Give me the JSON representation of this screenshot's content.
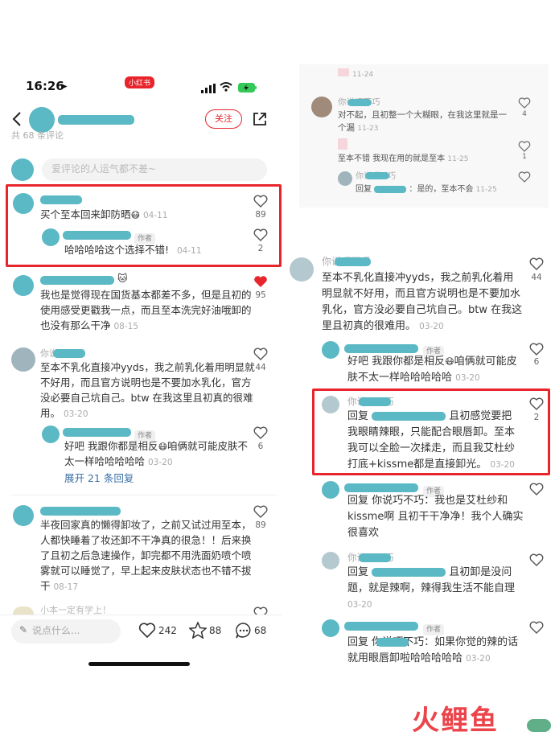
{
  "status_bar": {
    "time": "16:26",
    "app_badge": "小红书"
  },
  "header": {
    "follow_label": "关注",
    "count_label": "共 68 条评论"
  },
  "comment_input": {
    "placeholder": "爱评论的人运气都不差~"
  },
  "left_comments": [
    {
      "text": "买个至本回来卸防晒",
      "date": "04-11",
      "likes": "89"
    },
    {
      "author_tag": "作者",
      "text": "哈哈哈哈这个选择不错!",
      "date": "04-11",
      "likes": "2"
    },
    {
      "lines": [
        "我也是觉得现在国货基本都差不多，但是且初的",
        "使用感受更戳我一点，而且至本洗完好油哦卸的",
        "也没有那么干净"
      ],
      "date": "08-15",
      "likes": "95"
    },
    {
      "name": "你说巧不巧",
      "lines": [
        "至本不乳化直接冲yyds，我之前乳化着用明显就",
        "不好用，而且官方说明也是不要加水乳化，官方",
        "没必要自己坑自己。btw 在我这里且初真的很难",
        "用。"
      ],
      "date": "03-20",
      "likes": "44"
    },
    {
      "author_tag": "作者",
      "lines": [
        "好吧 我跟你都是相反",
        "咱俩就可能皮肤不",
        "太一样哈哈哈哈哈"
      ],
      "date": "03-20",
      "likes": "6"
    },
    {
      "expand": "展开 21 条回复"
    },
    {
      "lines": [
        "半夜回家真的懒得卸妆了，之前又试过用至本，",
        "人都快睡着了妆还卸不干净真的很急！！后来换",
        "了且初之后急速操作，卸完都不用洗面奶喷个喷",
        "雾就可以睡觉了，早上起来皮肤状态也不错不拔",
        "干"
      ],
      "date": "08-17",
      "likes": "89"
    },
    {
      "partial": "小本一定有学上！"
    }
  ],
  "bottom_bar": {
    "input_placeholder": "说点什么...",
    "likes": "242",
    "stars": "88",
    "comments": "68"
  },
  "right_comments": [
    {
      "date_top": "11-24"
    },
    {
      "name": "你说巧不巧",
      "lines": [
        "对不起，且初整一个大糊眼，在我这里就是一",
        "个漏"
      ],
      "date": "11-23",
      "likes": "4"
    },
    {
      "text": "至本不错 我现在用的就是至本",
      "date": "11-25",
      "likes": "1"
    },
    {
      "name": "你说巧不巧",
      "prefix": "回复",
      "text": "：是的，至本不会",
      "date": "11-25",
      "likes": ""
    },
    {
      "name": "你说巧不巧",
      "lines": [
        "至本不乳化直接冲yyds，我之前乳化着用",
        "明显就不好用，而且官方说明也是不要加水",
        "乳化，官方没必要自己坑自己。btw 在我这",
        "里且初真的很难用。"
      ],
      "date": "03-20",
      "likes": "44"
    },
    {
      "author_tag": "作者",
      "lines": [
        "好吧 我跟你都是相反",
        "咱俩就可能皮",
        "肤不太一样哈哈哈哈哈"
      ],
      "date": "03-20",
      "likes": "6"
    },
    {
      "name": "你说巧不巧",
      "prefix": "回复",
      "lines": [
        "且初感觉要把",
        "我眼睛辣眼，只能配合眼唇卸。至本",
        "我可以全脸一次揉走，而且我艾杜纱",
        "打底+kissme都是直接卸光。"
      ],
      "date": "03-20",
      "likes": "2"
    },
    {
      "author_tag": "作者",
      "lines": [
        "回复 你说巧不巧：我也是艾杜纱和",
        "kissme啊 且初干干净净！我个人确实",
        "很喜欢"
      ],
      "date": "",
      "likes": ""
    },
    {
      "name": "你说巧不巧",
      "prefix": "回复",
      "lines": [
        "且初卸是没问",
        "题，就是辣啊，辣得我生活不能自理"
      ],
      "date": "03-20",
      "likes": ""
    },
    {
      "author_tag": "作者",
      "lines": [
        "回复 你说巧不巧：如果你觉的辣的话",
        "就用眼唇卸啦哈哈哈哈哈"
      ],
      "date": "03-20",
      "likes": ""
    }
  ],
  "watermark": {
    "text": "火鲤鱼"
  }
}
